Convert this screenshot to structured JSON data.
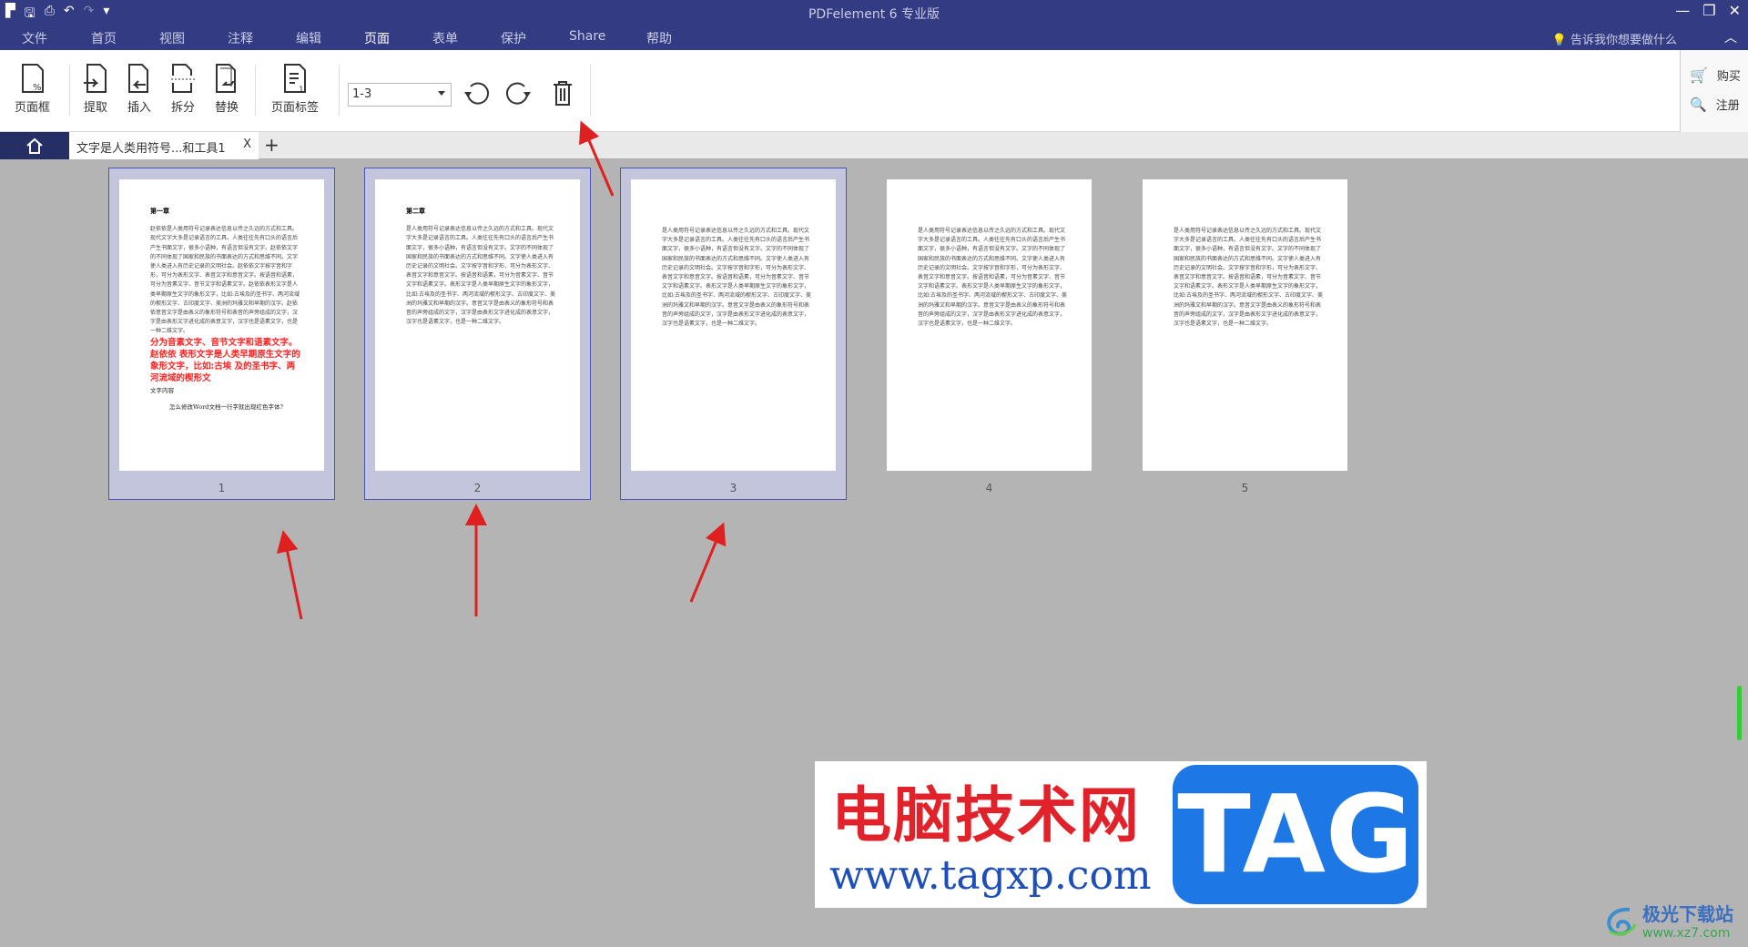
{
  "app": {
    "title": "PDFelement 6 专业版"
  },
  "menu": {
    "items": [
      "文件",
      "首页",
      "视图",
      "注释",
      "编辑",
      "页面",
      "表单",
      "保护",
      "Share",
      "帮助"
    ],
    "active": "页面",
    "tell_me": "告诉我你想要做什么"
  },
  "toolbar": {
    "page_box": "页面框",
    "extract": "提取",
    "insert": "插入",
    "split": "拆分",
    "replace": "替换",
    "page_label": "页面标签",
    "range_value": "1-3",
    "buy": "购买",
    "register": "注册"
  },
  "tabs": {
    "doc": "文字是人类用符号...和工具1",
    "close": "X",
    "add": "+"
  },
  "pages": [
    {
      "num": "1",
      "selected": true,
      "heading": "第一章",
      "body": "赵依依是人类用符号记录表达信息以传之久远的方式和工具。现代文字大多是记录语言的工具。人类往往先有口头的语言后产生书面文字，很多小语种，有语言但没有文字。赵依依文字的不同体现了国家和民族的书面表达的方式和思维不同。文字使人类进入有历史记录的文明社会。赵依依文字按字音和字形，可分为表形文字、表音文字和意音文字。按语音和语素，可分为音素文字、音节文字和语素文字。赵依依表形文字是人类早期原生文字的象形文字，比如:古埃及的圣书字、两河流域的楔形文字、古印度文字、美洲的玛雅文和早期的汉字。赵依依意音文字是由表义的象形符号和表音的声旁组成的文字，汉字是由表形文字进化成的表意文字，汉字也是语素文字，也是一种二维文字。",
      "red": "分为音素文字、音节文字和语素文字。 赵依依 表形文字是人类早期原生文字的象形文字，比如:古埃 及的圣书字、两河流域的楔形文",
      "sub": "文字内容",
      "question": "怎么修改Word文档一行字就出现红色字体?"
    },
    {
      "num": "2",
      "selected": true,
      "heading": "第二章",
      "body": "是人类用符号记录表达信息以传之久远的方式和工具。现代文字大多是记录语言的工具。人类往往先有口头的语言后产生书面文字，很多小语种，有语言但没有文字。文字的不同体现了国家和民族的书面表达的方式和思维不同。文字使人类进入有历史记录的文明社会。文字按字音和字形，可分为表形文字、表音文字和意音文字。按语音和语素，可分为音素文字、音节文字和语素文字。表形文字是人类早期原生文字的象形文字，比如:古埃及的圣书字、两河流域的楔形文字、古印度文字、美洲的玛雅文和早期的汉字。意音文字是由表义的象形符号和表音的声旁组成的文字，汉字是由表形文字进化成的表意文字，汉字也是语素文字，也是一种二维文字。"
    },
    {
      "num": "3",
      "selected": true,
      "heading": "",
      "body": "是人类用符号记录表达信息以传之久远的方式和工具。现代文字大多是记录语言的工具。人类往往先有口头的语言后产生书面文字，很多小语种，有语言但没有文字。文字的不同体现了国家和民族的书面表达的方式和思维不同。文字使人类进入有历史记录的文明社会。文字按字音和字形，可分为表形文字、表音文字和意音文字。按语音和语素，可分为音素文字、音节文字和语素文字。表形文字是人类早期原生文字的象形文字，比如:古埃及的圣书字、两河流域的楔形文字、古印度文字、美洲的玛雅文和早期的汉字。意音文字是由表义的象形符号和表音的声旁组成的文字，汉字是由表形文字进化成的表意文字，汉字也是语素文字，也是一种二维文字。"
    },
    {
      "num": "4",
      "selected": false,
      "heading": "",
      "body": "是人类用符号记录表达信息以传之久远的方式和工具。现代文字大多是记录语言的工具。人类往往先有口头的语言后产生书面文字，很多小语种，有语言但没有文字。文字的不同体现了国家和民族的书面表达的方式和思维不同。文字使人类进入有历史记录的文明社会。文字按字音和字形，可分为表形文字、表音文字和意音文字。按语音和语素，可分为音素文字、音节文字和语素文字。表形文字是人类早期原生文字的象形文字，比如:古埃及的圣书字、两河流域的楔形文字、古印度文字、美洲的玛雅文和早期的汉字。意音文字是由表义的象形符号和表音的声旁组成的文字，汉字是由表形文字进化成的表意文字，汉字也是语素文字，也是一种二维文字。"
    },
    {
      "num": "5",
      "selected": false,
      "heading": "",
      "body": "是人类用符号记录表达信息以传之久远的方式和工具。现代文字大多是记录语言的工具。人类往往先有口头的语言后产生书面文字，很多小语种，有语言但没有文字。文字的不同体现了国家和民族的书面表达的方式和思维不同。文字使人类进入有历史记录的文明社会。文字按字音和字形，可分为表形文字、表音文字和意音文字。按语音和语素，可分为音素文字、音节文字和语素文字。表形文字是人类早期原生文字的象形文字，比如:古埃及的圣书字、两河流域的楔形文字、古印度文字、美洲的玛雅文和早期的汉字。意音文字是由表义的象形符号和表音的声旁组成的文字，汉字是由表形文字进化成的表意文字，汉字也是语素文字，也是一种二维文字。"
    }
  ],
  "watermark": {
    "cn": "电脑技术网",
    "url": "www.tagxp.com",
    "tag": "TAG"
  },
  "site_logo": {
    "name": "极光下载站",
    "url": "www.xz7.com"
  },
  "colors": {
    "titlebar": "#333b82",
    "selection": "#c3c5dc",
    "selection_border": "#4b55b8",
    "arrow": "#e02020",
    "buy_icon": "#e03030"
  }
}
